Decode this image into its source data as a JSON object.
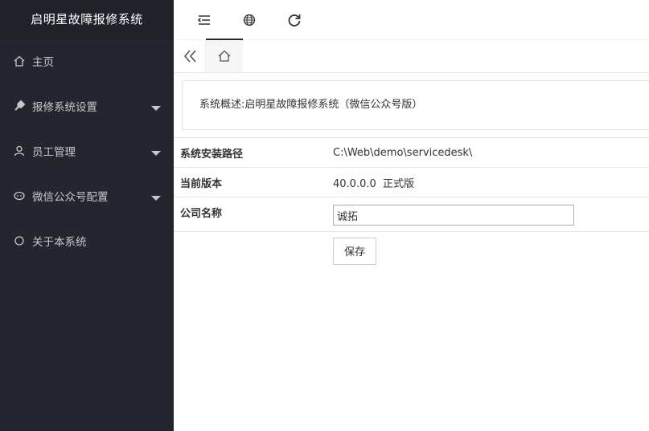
{
  "app": {
    "title": "启明星故障报修系统"
  },
  "sidebar": {
    "items": [
      {
        "label": "主页",
        "icon": "home-icon",
        "has_submenu": false
      },
      {
        "label": "报修系统设置",
        "icon": "wrench-icon",
        "has_submenu": true
      },
      {
        "label": "员工管理",
        "icon": "user-icon",
        "has_submenu": true
      },
      {
        "label": "微信公众号配置",
        "icon": "wechat-icon",
        "has_submenu": true
      },
      {
        "label": "关于本系统",
        "icon": "circle-icon",
        "has_submenu": false
      }
    ]
  },
  "header": {
    "icons": [
      "menu-toggle-icon",
      "globe-icon",
      "refresh-icon"
    ]
  },
  "tabs": {
    "prev_icon": "double-chevron-left-icon",
    "home_icon": "home-icon"
  },
  "summary": {
    "text": "系统概述:启明星故障报修系统（微信公众号版）"
  },
  "info": {
    "install_path_label": "系统安装路径",
    "install_path_value": "C:\\Web\\demo\\servicedesk\\",
    "version_label": "当前版本",
    "version_value": "40.0.0.0  正式版",
    "company_label": "公司名称",
    "company_value": "诚拓",
    "save_label": "保存"
  },
  "colors": {
    "sidebar_bg": "#23262e",
    "logo_bg": "#20222a",
    "tab_active_border": "#292b34"
  }
}
